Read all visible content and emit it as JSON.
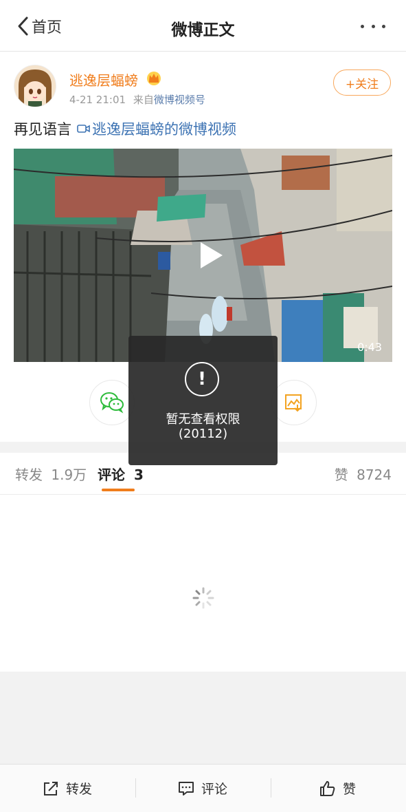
{
  "nav": {
    "back_label": "首页",
    "title": "微博正文"
  },
  "post": {
    "author": "逃逸层蝠螃",
    "time": "4-21 21:01",
    "source_prefix": "来自",
    "source": "微博视频号",
    "follow_label": "+关注",
    "text": "再见语言",
    "video_link": "逃逸层蝠螃的微博视频",
    "video_duration": "0:43"
  },
  "tabs": {
    "repost_label": "转发",
    "repost_count": "1.9万",
    "comment_label": "评论",
    "comment_count": "3",
    "like_label": "赞",
    "like_count": "8724"
  },
  "toast": {
    "message": "暂无查看权限",
    "code": "(20112)",
    "icon_glyph": "!"
  },
  "bottom_bar": {
    "repost": "转发",
    "comment": "评论",
    "like": "赞"
  },
  "colors": {
    "accent": "#f07d1c",
    "link": "#3d73b3",
    "muted": "#999999",
    "wechat_green": "#2dbb3b"
  },
  "icons": {
    "back": "chevron-left-icon",
    "more": "more-dots-icon",
    "crown": "crown-icon",
    "video_link": "video-camera-icon",
    "play": "play-icon",
    "wechat": "wechat-icon",
    "save_image": "save-image-icon",
    "spinner": "loading-spinner-icon",
    "repost": "repost-icon",
    "comment": "comment-icon",
    "like": "thumbs-up-icon"
  }
}
